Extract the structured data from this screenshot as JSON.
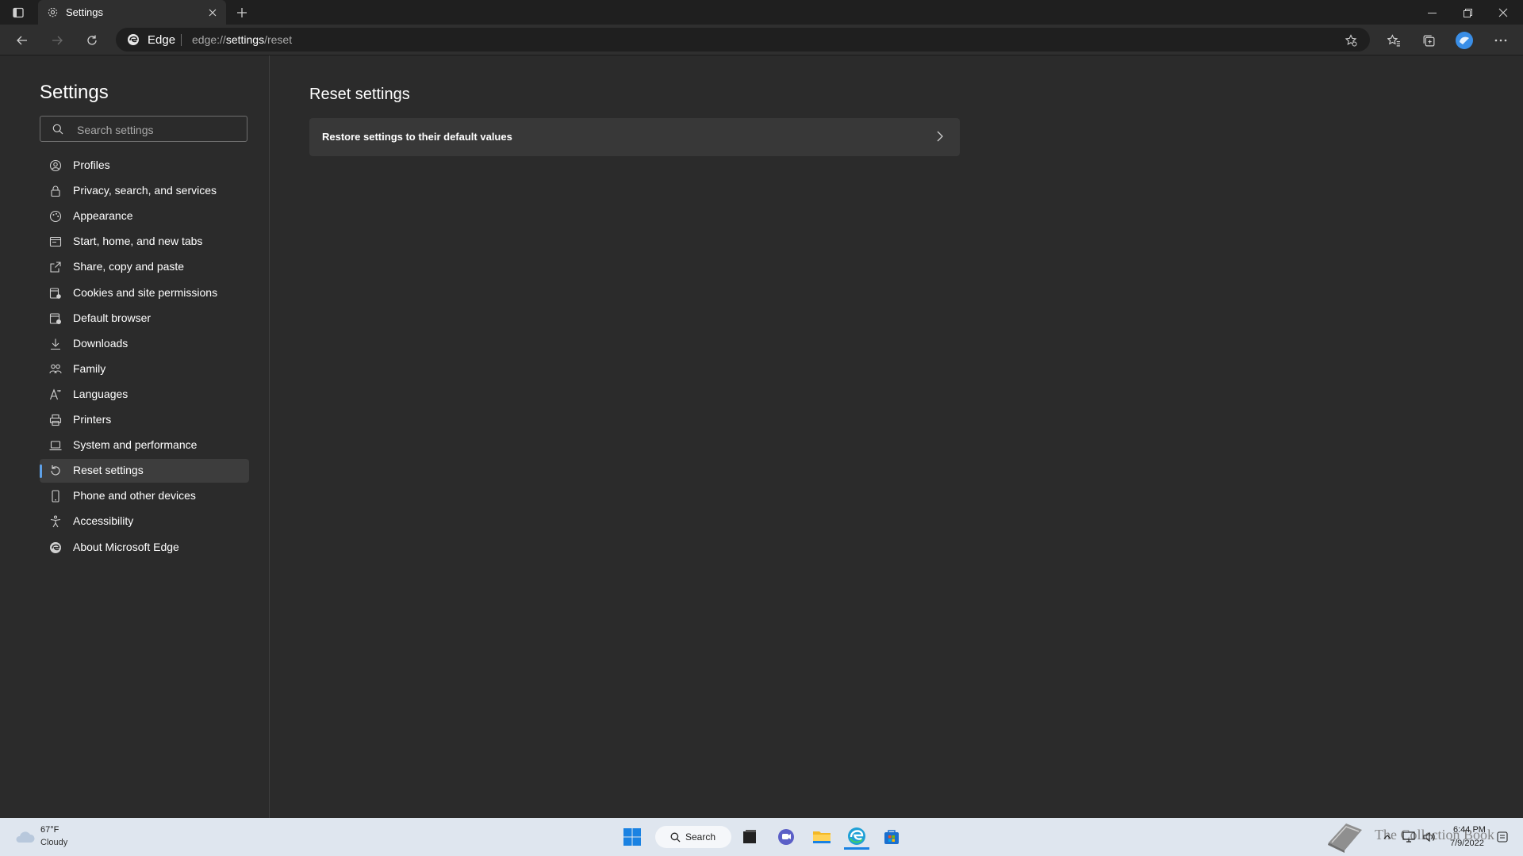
{
  "browser": {
    "tab": {
      "title": "Settings",
      "icon": "gear-icon"
    },
    "address_bar": {
      "brand": "Edge",
      "url_prefix": "edge://",
      "url_highlight": "settings",
      "url_suffix": "/reset"
    }
  },
  "sidebar": {
    "title": "Settings",
    "search_placeholder": "Search settings",
    "items": [
      {
        "label": "Profiles",
        "icon": "profile-icon",
        "active": false
      },
      {
        "label": "Privacy, search, and services",
        "icon": "lock-icon",
        "active": false
      },
      {
        "label": "Appearance",
        "icon": "appearance-icon",
        "active": false
      },
      {
        "label": "Start, home, and new tabs",
        "icon": "home-tabs-icon",
        "active": false
      },
      {
        "label": "Share, copy and paste",
        "icon": "share-icon",
        "active": false
      },
      {
        "label": "Cookies and site permissions",
        "icon": "cookies-icon",
        "active": false
      },
      {
        "label": "Default browser",
        "icon": "browser-icon",
        "active": false
      },
      {
        "label": "Downloads",
        "icon": "download-icon",
        "active": false
      },
      {
        "label": "Family",
        "icon": "family-icon",
        "active": false
      },
      {
        "label": "Languages",
        "icon": "language-icon",
        "active": false
      },
      {
        "label": "Printers",
        "icon": "printer-icon",
        "active": false
      },
      {
        "label": "System and performance",
        "icon": "laptop-icon",
        "active": false
      },
      {
        "label": "Reset settings",
        "icon": "reset-icon",
        "active": true
      },
      {
        "label": "Phone and other devices",
        "icon": "phone-icon",
        "active": false
      },
      {
        "label": "Accessibility",
        "icon": "accessibility-icon",
        "active": false
      },
      {
        "label": "About Microsoft Edge",
        "icon": "edge-icon",
        "active": false
      }
    ]
  },
  "main": {
    "title": "Reset settings",
    "card_label": "Restore settings to their default values"
  },
  "taskbar": {
    "weather_temp": "67°F",
    "weather_condition": "Cloudy",
    "search_label": "Search",
    "time": "6:44 PM",
    "date": "7/9/2022",
    "watermark": "The Collection Book"
  },
  "colors": {
    "accent": "#5ea1e8",
    "background": "#2b2b2b",
    "card": "#383838",
    "taskbar": "#dfe6ef"
  }
}
